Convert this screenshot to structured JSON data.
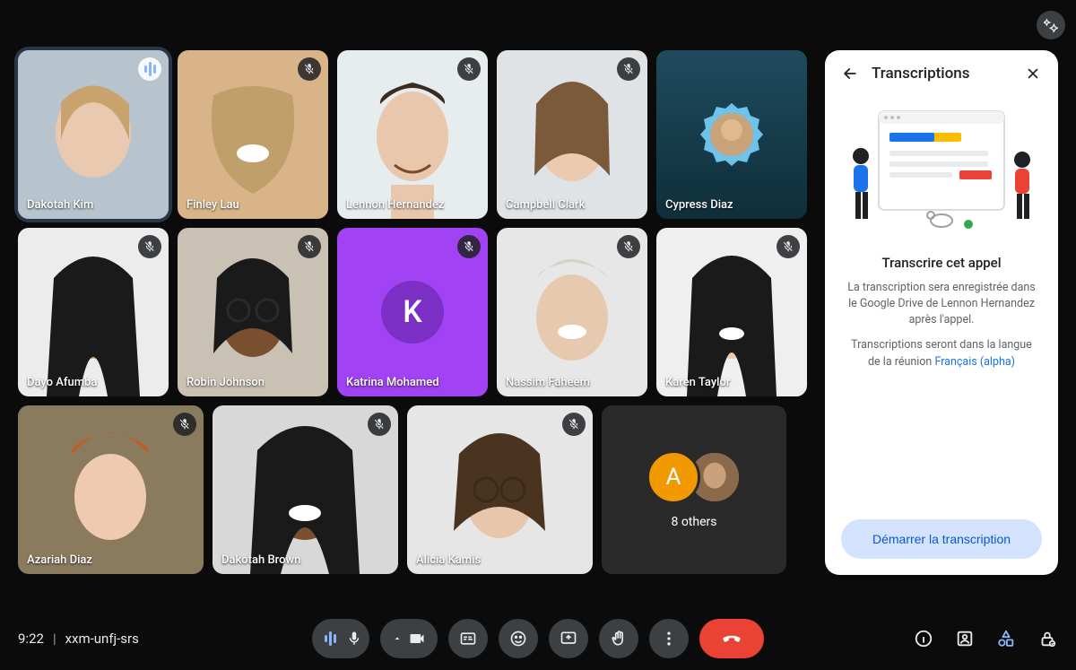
{
  "top": {
    "effects_label": "effects"
  },
  "grid": {
    "row1": [
      {
        "name": "Dakotah Kim",
        "speaking": true,
        "muted": false
      },
      {
        "name": "Finley Lau",
        "speaking": false,
        "muted": true
      },
      {
        "name": "Lennon Hernandez",
        "speaking": false,
        "muted": true
      },
      {
        "name": "Campbell Clark",
        "speaking": false,
        "muted": true
      },
      {
        "name": "Cypress Diaz",
        "speaking": false,
        "muted": false,
        "avatar": true
      }
    ],
    "row2": [
      {
        "name": "Dayo Afumba",
        "muted": true
      },
      {
        "name": "Robin Johnson",
        "muted": true
      },
      {
        "name": "Katrina Mohamed",
        "muted": true,
        "letter": "K",
        "color": "#a142f4"
      },
      {
        "name": "Nassim Faheem",
        "muted": true
      },
      {
        "name": "Karen Taylor",
        "muted": true
      }
    ],
    "row3": [
      {
        "name": "Azariah Diaz",
        "muted": true
      },
      {
        "name": "Dakotah Brown",
        "muted": true
      },
      {
        "name": "Alicia Kamis",
        "muted": true
      }
    ],
    "others": {
      "label": "8 others",
      "initial": "A"
    }
  },
  "panel": {
    "title": "Transcriptions",
    "heading": "Transcrire cet appel",
    "body1": "La transcription sera enregistrée dans le Google Drive de Lennon Hernandez après l'appel.",
    "body2_prefix": "Transcriptions seront dans la langue de la réunion ",
    "body2_link": "Français (alpha)",
    "button": "Démarrer la transcription"
  },
  "bottom": {
    "time": "9:22",
    "code": "xxm-unfj-srs"
  }
}
